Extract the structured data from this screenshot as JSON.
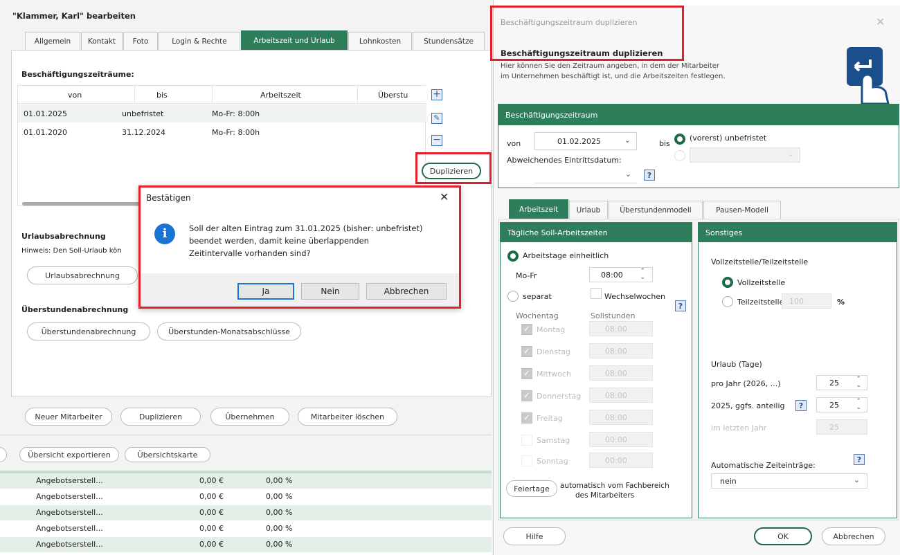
{
  "main": {
    "title": "\"Klammer, Karl\" bearbeiten",
    "tabs": [
      "Allgemein",
      "Kontakt",
      "Foto",
      "Login & Rechte",
      "Arbeitszeit und Urlaub",
      "Lohnkosten",
      "Stundensätze"
    ],
    "section_title": "Beschäftigungszeiträume:",
    "table": {
      "headers": [
        "von",
        "bis",
        "Arbeitszeit",
        "Überstu"
      ],
      "rows": [
        [
          "01.01.2025",
          "unbefristet",
          "Mo-Fr: 8:00h"
        ],
        [
          "01.01.2020",
          "31.12.2024",
          "Mo-Fr: 8:00h"
        ]
      ]
    },
    "duplizieren": "Duplizieren",
    "urlaub_title": "Urlaubsabrechnung",
    "hinweis": "Hinweis: Den Soll-Urlaub kön",
    "urlaub_btn": "Urlaubsabrechnung",
    "ueberstunden_title": "Überstundenabrechnung",
    "ueberstunden_btn": "Überstundenabrechnung",
    "monats_btn": "Überstunden-Monatsabschlüsse",
    "bottom_buttons": [
      "Neuer Mitarbeiter",
      "Duplizieren",
      "Übernehmen",
      "Mitarbeiter löschen"
    ],
    "export_buttons": [
      "Übersicht exportieren",
      "Übersichtskarte"
    ],
    "list_rows": [
      [
        "Angebotserstell...",
        "0,00 €",
        "0,00 %"
      ],
      [
        "Angebotserstell...",
        "0,00 €",
        "0,00 %"
      ],
      [
        "Angebotserstell...",
        "0,00 €",
        "0,00 %"
      ],
      [
        "Angebotserstell...",
        "0,00 €",
        "0,00 %"
      ],
      [
        "Angebotserstell...",
        "0,00 €",
        "0,00 %"
      ]
    ]
  },
  "confirm": {
    "title": "Bestätigen",
    "line1": "Soll der alten Eintrag zum 31.01.2025 (bisher: unbefristet)",
    "line2": "beendet werden, damit keine überlappenden",
    "line3": "Zeitintervalle vorhanden sind?",
    "yes": "Ja",
    "no": "Nein",
    "cancel": "Abbrechen"
  },
  "dup": {
    "window_title": "Beschäftigungszeitraum duplizieren",
    "heading": "Beschäftigungszeitraum duplizieren",
    "desc1": "Hier können Sie den Zeitraum angeben, in dem der Mitarbeiter",
    "desc2": "im Unternehmen beschäftigt ist, und die Arbeitszeiten festlegen.",
    "period_header": "Beschäftigungszeitraum",
    "von_label": "von",
    "von_value": "01.02.2025",
    "bis_label": "bis",
    "unbefristet": "(vorerst) unbefristet",
    "abw_label": "Abweichendes Eintrittsdatum:",
    "tabs": [
      "Arbeitszeit",
      "Urlaub",
      "Überstundenmodell",
      "Pausen-Modell"
    ],
    "daily_header": "Tägliche Soll-Arbeitszeiten",
    "einheitlich": "Arbeitstage einheitlich",
    "mofr": "Mo-Fr",
    "mofr_time": "08:00",
    "separat": "separat",
    "wechsel": "Wechselwochen",
    "wochentag": "Wochentag",
    "sollstunden": "Sollstunden",
    "days": [
      "Montag",
      "Dienstag",
      "Mittwoch",
      "Donnerstag",
      "Freitag",
      "Samstag",
      "Sonntag"
    ],
    "day_times": [
      "08:00",
      "08:00",
      "08:00",
      "08:00",
      "08:00",
      "00:00",
      "00:00"
    ],
    "feiertage": "Feiertage",
    "feiertage_text1": "automatisch vom Fachbereich",
    "feiertage_text2": "des Mitarbeiters",
    "sonstiges_header": "Sonstiges",
    "vollteil": "Vollzeitstelle/Teilzeitstelle",
    "vollzeit": "Vollzeitstelle",
    "teilzeit": "Teilzeitstelle",
    "teil_value": "100",
    "percent": "%",
    "urlaub_tage": "Urlaub (Tage)",
    "pro_jahr": "pro Jahr (2026, ...)",
    "pro_jahr_val": "25",
    "anteilig": "2025, ggfs. anteilig",
    "anteilig_val": "25",
    "letzten": "im letzten Jahr",
    "letzten_val": "25",
    "auto_label": "Automatische Zeiteinträge:",
    "auto_value": "nein",
    "help": "Hilfe",
    "ok": "OK",
    "cancel": "Abbrechen"
  }
}
